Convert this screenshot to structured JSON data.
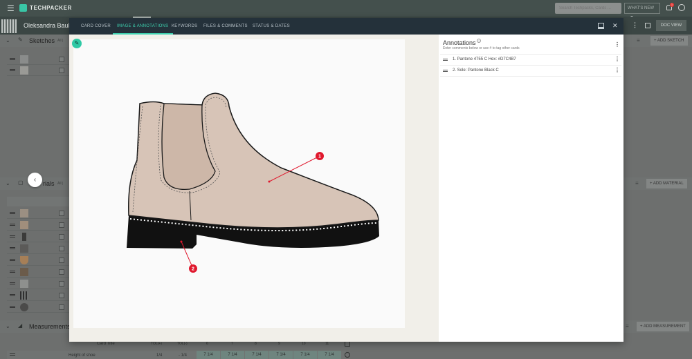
{
  "app": {
    "logo_text": "TECHPACKER",
    "search_placeholder": "Search Techpacks, Cards ...",
    "whats_new": "WHAT'S NEW",
    "notification_count": "1"
  },
  "product": {
    "name": "Oleksandra Bauk",
    "doc_view": "DOC VIEW"
  },
  "sections": {
    "sketches": {
      "title": "Sketches",
      "sub": "All | ",
      "add_label": "ADD SKETCH"
    },
    "materials": {
      "title": "rials",
      "sub": "All | ",
      "add_label": "ADD MATERIAL"
    },
    "measurements": {
      "title": "Measurements",
      "add_label": "ADD MEASUREMENT"
    }
  },
  "measurement_table": {
    "headers": [
      "Card Title",
      "TOL(+)",
      "TOL(-)",
      "6",
      "7",
      "8",
      "9",
      "10",
      "11"
    ],
    "row": [
      "Height of shoe",
      "1/4",
      "- 1/4",
      "7 1/4",
      "7 1/4",
      "7 1/4",
      "7 1/4",
      "7 1/4",
      "7 1/4"
    ]
  },
  "modal": {
    "tabs": [
      "CARD COVER",
      "IMAGE & ANNOTATIONS",
      "KEYWORDS",
      "FILES & COMMENTS",
      "STATUS & DATES"
    ],
    "active_tab": 1,
    "annotations_title": "Annotations",
    "annotations_hint": "Enter comments below or use # to tag other cards",
    "annotations": [
      {
        "label": "1.  Pantone 4755 C Hex: #D7C4B7"
      },
      {
        "label": "2.  Sole: Pantone Black C"
      }
    ],
    "markers": [
      "1",
      "2"
    ]
  },
  "colors": {
    "accent": "#3ed0ae",
    "marker": "#e0182d",
    "upper": "#d7c4b7",
    "sole": "#111111"
  },
  "icons": {
    "menu": "hamburger-icon",
    "prev": "chevron-left-icon",
    "edit": "pencil-icon",
    "close": "close-icon"
  }
}
